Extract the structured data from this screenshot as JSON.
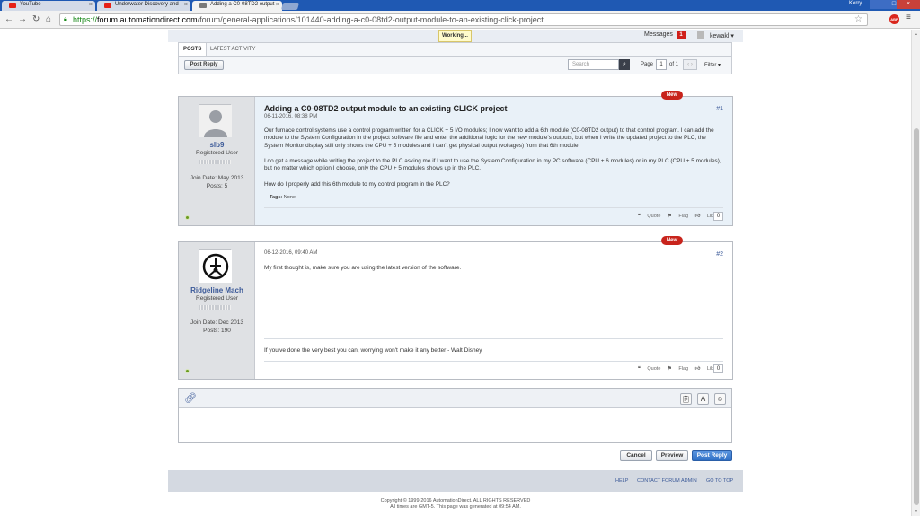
{
  "browser": {
    "tabs": [
      {
        "title": "YouTube",
        "favicon_color": "#e62117"
      },
      {
        "title": "Underwater Discovery and",
        "favicon_color": "#e62117"
      },
      {
        "title": "Adding a C0-08TD2 output",
        "favicon_color": "#7a7a7a"
      }
    ],
    "profile_name": "Kerry",
    "url_secure": "https://",
    "url_domain": "forum.automationdirect.com",
    "url_path": "/forum/general-applications/101440-adding-a-c0-08td2-output-module-to-an-existing-click-project",
    "abp_label": "ABP"
  },
  "topbar": {
    "working_label": "Working...",
    "messages_label": "Messages",
    "messages_count": "1",
    "username": "kewakl"
  },
  "forum_tabs": {
    "posts": "Posts",
    "latest_activity": "Latest Activity",
    "post_reply_label": "Post Reply",
    "search_placeholder": "Search",
    "page_label": "Page",
    "page_value": "1",
    "page_of": "of 1",
    "filter_label": "Filter"
  },
  "posts": [
    {
      "badge": "New",
      "author": "slb9",
      "role": "Registered User",
      "join_date": "Join Date: May 2013",
      "posts": "Posts: 5",
      "title": "Adding a C0-08TD2 output module to an existing CLICK project",
      "date": "06-11-2016, 08:38 PM",
      "number": "#1",
      "paragraphs": [
        "Our furnace control systems use a control program written for a CLICK + 5 I/O modules; I now want to add a 6th module (C0-08TD2 output) to that control program. I can add the module to the System Configuration in the project software file and enter the additional logic for the new module's outputs, but when I write the updated project to the PLC, the System Monitor display still only shows the CPU + 5 modules and I can't get physical output (voltages) from that 6th module.",
        "I do get a message while writing the project to the PLC asking me if I want to use the System Configuration in my PC software (CPU + 6 modules) or in my PLC (CPU + 5 modules), but no matter which option I choose, only the CPU + 5 modules shows up in the PLC.",
        "How do I properly add this 6th module to my control program in the PLC?"
      ],
      "tags_label": "Tags:",
      "tags_value": "None",
      "quote": "Quote",
      "flag": "Flag",
      "like": "Like",
      "like_count": "0"
    },
    {
      "badge": "New",
      "author": "Ridgeline Mach",
      "role": "Registered User",
      "join_date": "Join Date: Dec 2013",
      "posts": "Posts: 190",
      "date": "06-12-2016, 09:40 AM",
      "number": "#2",
      "text": "My first thought is, make sure you are using the latest version of the software.",
      "signature": "If you've done the very best you can, worrying won't make it any better - Walt Disney",
      "quote": "Quote",
      "flag": "Flag",
      "like": "Like",
      "like_count": "0"
    }
  ],
  "editor_actions": {
    "cancel": "Cancel",
    "preview": "Preview",
    "post_reply": "Post Reply"
  },
  "footer": {
    "help": "Help",
    "contact": "Contact Forum Admin",
    "top": "Go to top",
    "copyright": "Copyright © 1999-2016 AutomationDirect. ALL RIGHTS RESERVED",
    "timezone": "All times are GMT-5. This page was generated at 09:54 AM."
  }
}
